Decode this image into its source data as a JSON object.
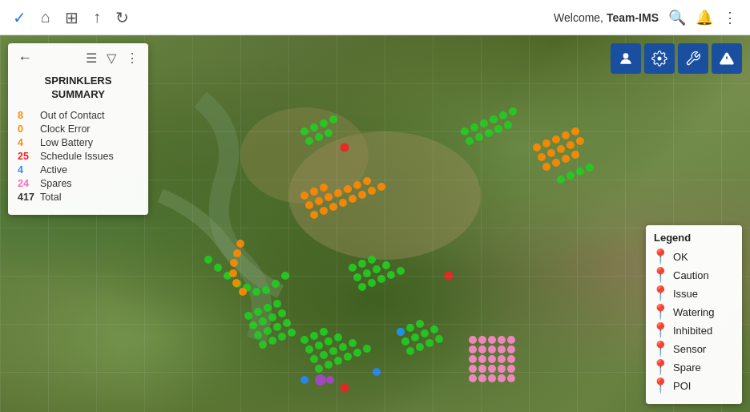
{
  "navbar": {
    "icons": [
      {
        "name": "check-icon",
        "glyph": "✓"
      },
      {
        "name": "home-icon",
        "glyph": "⌂"
      },
      {
        "name": "grid-icon",
        "glyph": "⊞"
      },
      {
        "name": "upload-icon",
        "glyph": "↑"
      },
      {
        "name": "refresh-icon",
        "glyph": "↻"
      }
    ],
    "welcome_text": "Welcome, ",
    "username": "Team-IMS",
    "right_icons": [
      {
        "name": "search-icon",
        "glyph": "🔍"
      },
      {
        "name": "bell-icon",
        "glyph": "🔔"
      },
      {
        "name": "more-icon",
        "glyph": "⋮"
      }
    ]
  },
  "sidebar": {
    "title": "SPRINKLERS\nSUMMARY",
    "back_label": "←",
    "toolbar_icons": [
      {
        "name": "list-icon",
        "glyph": "☰"
      },
      {
        "name": "filter-icon",
        "glyph": "▽"
      },
      {
        "name": "more-icon",
        "glyph": "⋮"
      }
    ],
    "stats": [
      {
        "label": "Out of Contact",
        "value": "8",
        "color": "orange"
      },
      {
        "label": "Clock Error",
        "value": "0",
        "color": "orange"
      },
      {
        "label": "Low Battery",
        "value": "4",
        "color": "orange"
      },
      {
        "label": "Schedule Issues",
        "value": "25",
        "color": "red"
      },
      {
        "label": "Active",
        "value": "4",
        "color": "blue"
      },
      {
        "label": "Spares",
        "value": "24",
        "color": "pink"
      },
      {
        "label": "Total",
        "value": "417",
        "color": "dark"
      }
    ]
  },
  "map_controls": [
    {
      "name": "person-layer-btn",
      "glyph": "👤"
    },
    {
      "name": "settings-layer-btn",
      "glyph": "⚙"
    },
    {
      "name": "tools-layer-btn",
      "glyph": "⚙"
    },
    {
      "name": "alert-layer-btn",
      "glyph": "⚠"
    }
  ],
  "legend": {
    "title": "Legend",
    "items": [
      {
        "label": "OK",
        "pin_class": "pin-green",
        "glyph": "📍"
      },
      {
        "label": "Caution",
        "pin_class": "pin-orange",
        "glyph": "📍"
      },
      {
        "label": "Issue",
        "pin_class": "pin-red",
        "glyph": "📍"
      },
      {
        "label": "Watering",
        "pin_class": "pin-blue",
        "glyph": "📍"
      },
      {
        "label": "Inhibited",
        "pin_class": "pin-dark",
        "glyph": "📍"
      },
      {
        "label": "Sensor",
        "pin_class": "pin-purple",
        "glyph": "📍"
      },
      {
        "label": "Spare",
        "pin_class": "pin-pink",
        "glyph": "📍"
      },
      {
        "label": "POI",
        "pin_class": "pin-darkred",
        "glyph": "📍"
      }
    ]
  }
}
